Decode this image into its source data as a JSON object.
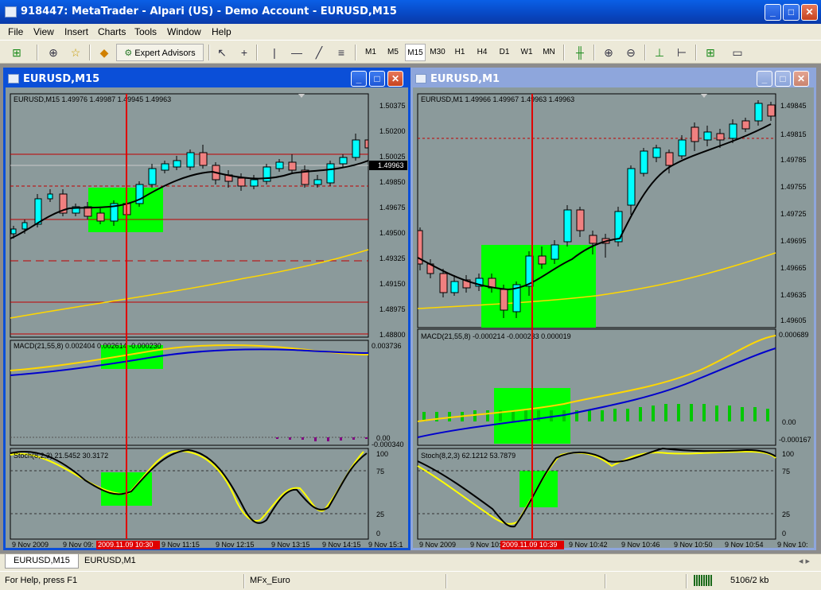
{
  "app": {
    "title": "918447: MetaTrader - Alpari (US) - Demo Account - EURUSD,M15",
    "min": "_",
    "max": "□",
    "close": "✕"
  },
  "menu": [
    "File",
    "View",
    "Insert",
    "Charts",
    "Tools",
    "Window",
    "Help"
  ],
  "toolbar": {
    "expert_advisors": "Expert Advisors",
    "timeframes": [
      "M1",
      "M5",
      "M15",
      "M30",
      "H1",
      "H4",
      "D1",
      "W1",
      "MN"
    ],
    "selected_timeframe": "M15"
  },
  "windows": {
    "left": {
      "title": "EURUSD,M15",
      "price_header": "EURUSD,M15  1.49976 1.49987 1.49945 1.49963",
      "price_labels": [
        "1.50375",
        "1.50200",
        "1.50025",
        "1.49850",
        "1.49675",
        "1.49500",
        "1.49325",
        "1.49150",
        "1.48975",
        "1.48800"
      ],
      "current_price": "1.49963",
      "macd_header": "MACD(21,55,8) 0.002404 0.002614 -0.000230",
      "macd_labels": [
        "0.003736",
        "0.00",
        "-0.000340"
      ],
      "stoch_header": "Stoch(8,2,3) 21.5452 30.3172",
      "stoch_labels": [
        "100",
        "75",
        "25",
        "0"
      ],
      "time_labels": [
        "9 Nov 2009",
        "9 Nov 09:",
        "9 Nov 11:15",
        "9 Nov 12:15",
        "9 Nov 13:15",
        "9 Nov 14:15",
        "9 Nov 15:1"
      ],
      "cursor_time": "2009.11.09 10:30"
    },
    "right": {
      "title": "EURUSD,M1",
      "price_header": "EURUSD,M1  1.49966 1.49967 1.49963 1.49963",
      "price_labels": [
        "1.49845",
        "1.49815",
        "1.49785",
        "1.49755",
        "1.49725",
        "1.49695",
        "1.49665",
        "1.49635",
        "1.49605"
      ],
      "macd_header": "MACD(21,55,8) -0.000214 -0.000233 0.000019",
      "macd_labels": [
        "0.000689",
        "0.00",
        "-0.000167"
      ],
      "stoch_header": "Stoch(8,2,3) 62.1212 53.7879",
      "stoch_labels": [
        "100",
        "75",
        "25",
        "0"
      ],
      "time_labels": [
        "9 Nov 2009",
        "9 Nov 10:",
        "9 Nov 10:42",
        "9 Nov 10:46",
        "9 Nov 10:50",
        "9 Nov 10:54",
        "9 Nov 10:"
      ],
      "cursor_time": "2009.11.09 10:39"
    }
  },
  "tabs": [
    "EURUSD,M15",
    "EURUSD,M1"
  ],
  "tabs_nav": "◂  ▸",
  "status": {
    "help": "For Help, press F1",
    "profile": "MFx_Euro",
    "traffic": "5106/2 kb"
  },
  "colors": {
    "chart_bg": "#8b9a9b",
    "bull": "#00ffff",
    "bear": "#f08080",
    "highlight": "#00ff00",
    "cursor_line": "#e00000",
    "ma_slow": "#ffd700",
    "macd_signal": "#ffd700",
    "macd_main": "#0000cd"
  }
}
